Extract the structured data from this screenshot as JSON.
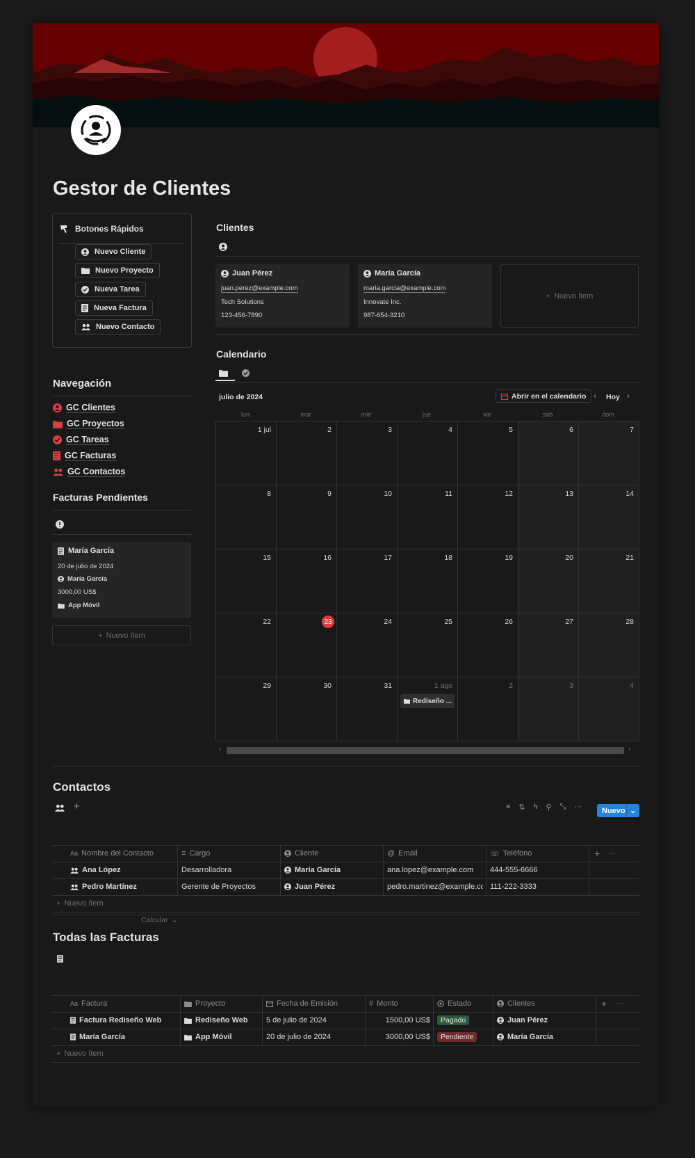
{
  "title": "Gestor de Clientes",
  "quick_buttons": {
    "title": "Botones Rápidos",
    "items": [
      "Nuevo Cliente",
      "Nuevo Proyecto",
      "Nueva Tarea",
      "Nueva Factura",
      "Nuevo Contacto"
    ]
  },
  "navigation": {
    "title": "Navegación",
    "items": [
      "GC Clientes",
      "GC Proyectos",
      "GC Tareas",
      "GC Facturas",
      "GC Contactos"
    ]
  },
  "pending": {
    "title": "Facturas Pendientes",
    "card": {
      "title": "María García",
      "date": "20 de julio de 2024",
      "client": "María García",
      "amount": "3000,00 US$",
      "project": "App Móvil"
    },
    "new_item": "Nuevo ítem"
  },
  "clients": {
    "title": "Clientes",
    "cards": [
      {
        "name": "Juan Pérez",
        "email": "juan.perez@example.com",
        "company": "Tech Solutions",
        "phone": "123-456-7890"
      },
      {
        "name": "María García",
        "email": "maria.garcia@example.com",
        "company": "Innovate Inc.",
        "phone": "987-654-3210"
      }
    ],
    "new_item": "Nuevo ítem"
  },
  "calendar": {
    "title": "Calendario",
    "month": "julio de 2024",
    "open_button": "Abrir en el calendario",
    "today_button": "Hoy",
    "weekdays": [
      "lun",
      "mar",
      "mié",
      "jue",
      "vie",
      "sáb",
      "dom"
    ],
    "days": [
      "1 jul",
      "2",
      "3",
      "4",
      "5",
      "6",
      "7",
      "8",
      "9",
      "10",
      "11",
      "12",
      "13",
      "14",
      "15",
      "16",
      "17",
      "18",
      "19",
      "20",
      "21",
      "22",
      "23",
      "24",
      "25",
      "26",
      "27",
      "28",
      "29",
      "30",
      "31",
      "1 ago",
      "2",
      "3",
      "4"
    ],
    "today_index": 22,
    "event": {
      "day_index": 31,
      "label": "Rediseño ..."
    }
  },
  "contacts": {
    "title": "Contactos",
    "new_button": "Nuevo",
    "columns": [
      "Nombre del Contacto",
      "Cargo",
      "Cliente",
      "Email",
      "Teléfono"
    ],
    "rows": [
      {
        "name": "Ana López",
        "role": "Desarrolladora",
        "client": "María García",
        "email": "ana.lopez@example.com",
        "phone": "444-555-6666"
      },
      {
        "name": "Pedro Martínez",
        "role": "Gerente de Proyectos",
        "client": "Juan Pérez",
        "email": "pedro.martinez@example.com",
        "phone": "111-222-3333"
      }
    ],
    "new_item": "Nuevo ítem",
    "calculate": "Calcular"
  },
  "invoices": {
    "title": "Todas las Facturas",
    "columns": [
      "Factura",
      "Proyecto",
      "Fecha de Emisión",
      "Monto",
      "Estado",
      "Clientes"
    ],
    "rows": [
      {
        "invoice": "Factura Rediseño Web",
        "project": "Rediseño Web",
        "date": "5 de julio de 2024",
        "amount": "1500,00 US$",
        "status": "Pagado",
        "client": "Juan Pérez"
      },
      {
        "invoice": "María García",
        "project": "App Móvil",
        "date": "20 de julio de 2024",
        "amount": "3000,00 US$",
        "status": "Pendiente",
        "client": "María García"
      }
    ],
    "new_item": "Nuevo ítem"
  },
  "colors": {
    "accent": "#2383e2",
    "red": "#e03e3e",
    "paid_bg": "#2b5a3a",
    "pending_bg": "#6e2b2b"
  }
}
